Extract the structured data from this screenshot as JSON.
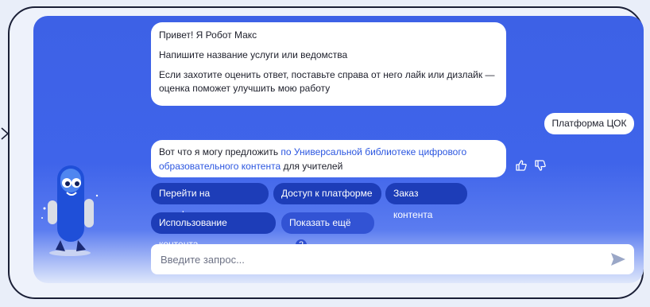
{
  "messages": {
    "greeting": "Привет! Я Робот Макс",
    "prompt": "Напишите название услуги или ведомства",
    "rating_hint": "Если захотите оценить ответ, поставьте справа от него лайк или дизлайк — оценка поможет улучшить мою работу",
    "user_query": "Платформа ЦОК",
    "reply_prefix": "Вот что я могу предложить",
    "reply_link": "по Универсальной библиотеке цифрового образовательного контента",
    "reply_suffix": "для учителей"
  },
  "chips": {
    "go_platform": "Перейти на платформу",
    "access": "Доступ к платформе",
    "order": "Заказ контента",
    "usage": "Использование контента",
    "show_more": "Показать ещё",
    "show_more_count": "2"
  },
  "input": {
    "placeholder": "Введите запрос..."
  },
  "icons": {
    "like": "thumbs-up-icon",
    "dislike": "thumbs-down-icon",
    "send": "send-icon",
    "mascot": "robot-mascot"
  },
  "colors": {
    "chat_bg": "#3d61e6",
    "chip_bg": "#1d3db8",
    "link": "#2b56e0",
    "border": "#1a1f36"
  }
}
